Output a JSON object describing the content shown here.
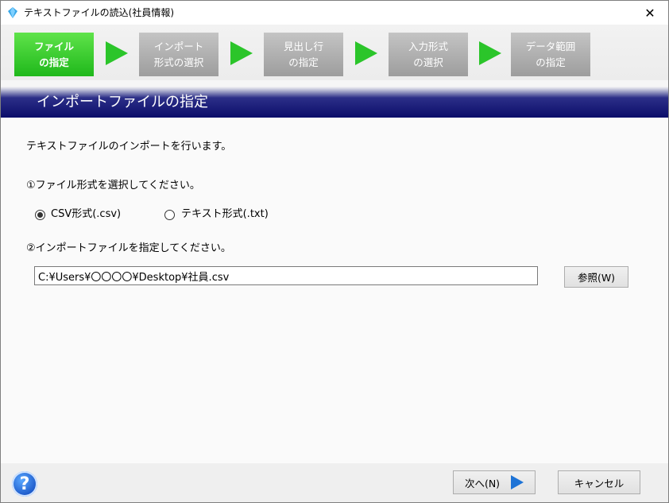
{
  "window": {
    "title": "テキストファイルの読込(社員情報)",
    "close_label": "✕"
  },
  "steps": [
    {
      "line1": "ファイル",
      "line2": "の指定",
      "active": true
    },
    {
      "line1": "インポート",
      "line2": "形式の選択",
      "active": false
    },
    {
      "line1": "見出し行",
      "line2": "の指定",
      "active": false
    },
    {
      "line1": "入力形式",
      "line2": "の選択",
      "active": false
    },
    {
      "line1": "データ範囲",
      "line2": "の指定",
      "active": false
    }
  ],
  "banner": {
    "title": "インポートファイルの指定"
  },
  "main": {
    "intro": "テキストファイルのインポートを行います。",
    "step1_label": "①ファイル形式を選択してください。",
    "format_options": [
      {
        "label": "CSV形式(.csv)",
        "checked": true
      },
      {
        "label": "テキスト形式(.txt)",
        "checked": false
      }
    ],
    "step2_label": "②インポートファイルを指定してください。",
    "file_path": "C:¥Users¥〇〇〇〇¥Desktop¥社員.csv",
    "browse_label": "参照(W)"
  },
  "footer": {
    "help_glyph": "?",
    "next_label": "次へ(N)",
    "cancel_label": "キャンセル"
  },
  "colors": {
    "active_step": "#2bc52a",
    "banner": "#0b0d6a",
    "next_arrow": "#1d73d6"
  },
  "icons": {
    "app": "diamond-app-icon",
    "help": "help-icon",
    "next": "play-arrow-icon",
    "step_arrow": "green-arrow-icon"
  }
}
